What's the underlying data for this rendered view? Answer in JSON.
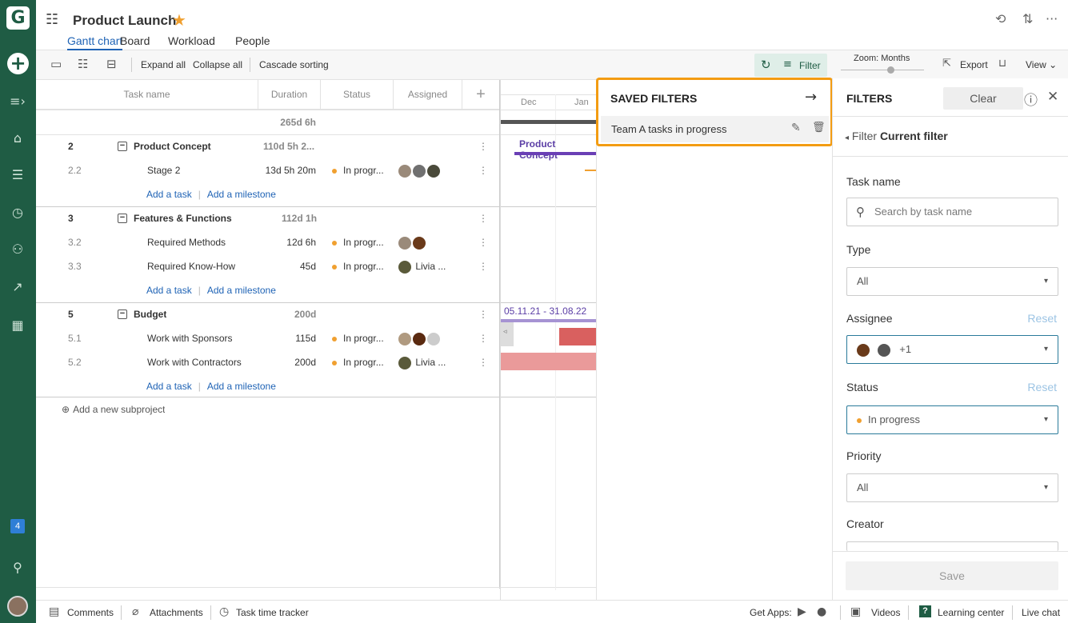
{
  "project": {
    "title": "Product Launch"
  },
  "view_tabs": [
    "Gantt chart",
    "Board",
    "Workload",
    "People"
  ],
  "sidebar": {
    "notification_count": "4"
  },
  "toolbar": {
    "expand_all": "Expand all",
    "collapse_all": "Collapse all",
    "cascade_sorting": "Cascade sorting",
    "filter": "Filter",
    "zoom_label": "Zoom:",
    "zoom_value": "Months",
    "export": "Export",
    "view": "View"
  },
  "grid": {
    "columns": [
      "Task name",
      "Duration",
      "Status",
      "Assigned"
    ],
    "total_duration": "265d 6h",
    "add_task": "Add a task",
    "add_milestone": "Add a milestone",
    "add_subproject": "Add a new subproject",
    "rows": [
      {
        "id": "2",
        "name": "Product Concept",
        "duration": "110d 5h 2...",
        "group": true
      },
      {
        "id": "2.2",
        "name": "Stage 2",
        "duration": "13d 5h 20m",
        "status": "In progr...",
        "assigned": ""
      },
      {
        "id": "3",
        "name": "Features & Functions",
        "duration": "112d 1h",
        "group": true
      },
      {
        "id": "3.2",
        "name": "Required Methods",
        "duration": "12d 6h",
        "status": "In progr...",
        "assigned": ""
      },
      {
        "id": "3.3",
        "name": "Required Know-How",
        "duration": "45d",
        "status": "In progr...",
        "assigned": "Livia ..."
      },
      {
        "id": "5",
        "name": "Budget",
        "duration": "200d",
        "group": true
      },
      {
        "id": "5.1",
        "name": "Work with Sponsors",
        "duration": "115d",
        "status": "In progr...",
        "assigned": ""
      },
      {
        "id": "5.2",
        "name": "Work with Contractors",
        "duration": "200d",
        "status": "In progr...",
        "assigned": "Livia ..."
      }
    ]
  },
  "timeline": {
    "months": [
      "Dec",
      "Jan"
    ],
    "bar_label_concept": "Product Concept",
    "budget_range": "05.11.21 - 31.08.22"
  },
  "saved_filters": {
    "title": "SAVED FILTERS",
    "items": [
      "Team A tasks in progress"
    ]
  },
  "filters": {
    "title": "FILTERS",
    "clear": "Clear",
    "breadcrumb_parent": "Filter",
    "breadcrumb_current": "Current filter",
    "task_name_label": "Task name",
    "task_name_placeholder": "Search by task name",
    "type_label": "Type",
    "type_value": "All",
    "assignee_label": "Assignee",
    "assignee_extra": "+1",
    "status_label": "Status",
    "status_value": "In progress",
    "priority_label": "Priority",
    "priority_value": "All",
    "creator_label": "Creator",
    "reset": "Reset",
    "save": "Save"
  },
  "footer": {
    "comments": "Comments",
    "attachments": "Attachments",
    "time_tracker": "Task time tracker",
    "get_apps": "Get Apps:",
    "videos": "Videos",
    "learning_center": "Learning center",
    "live_chat": "Live chat"
  },
  "colors": {
    "sidebar": "#1f5c44",
    "accent": "#1f63b5",
    "highlight": "#f39c12",
    "bar_purple": "#6a3fb5",
    "bar_red": "#d9605f",
    "status_dot": "#f0a030"
  }
}
